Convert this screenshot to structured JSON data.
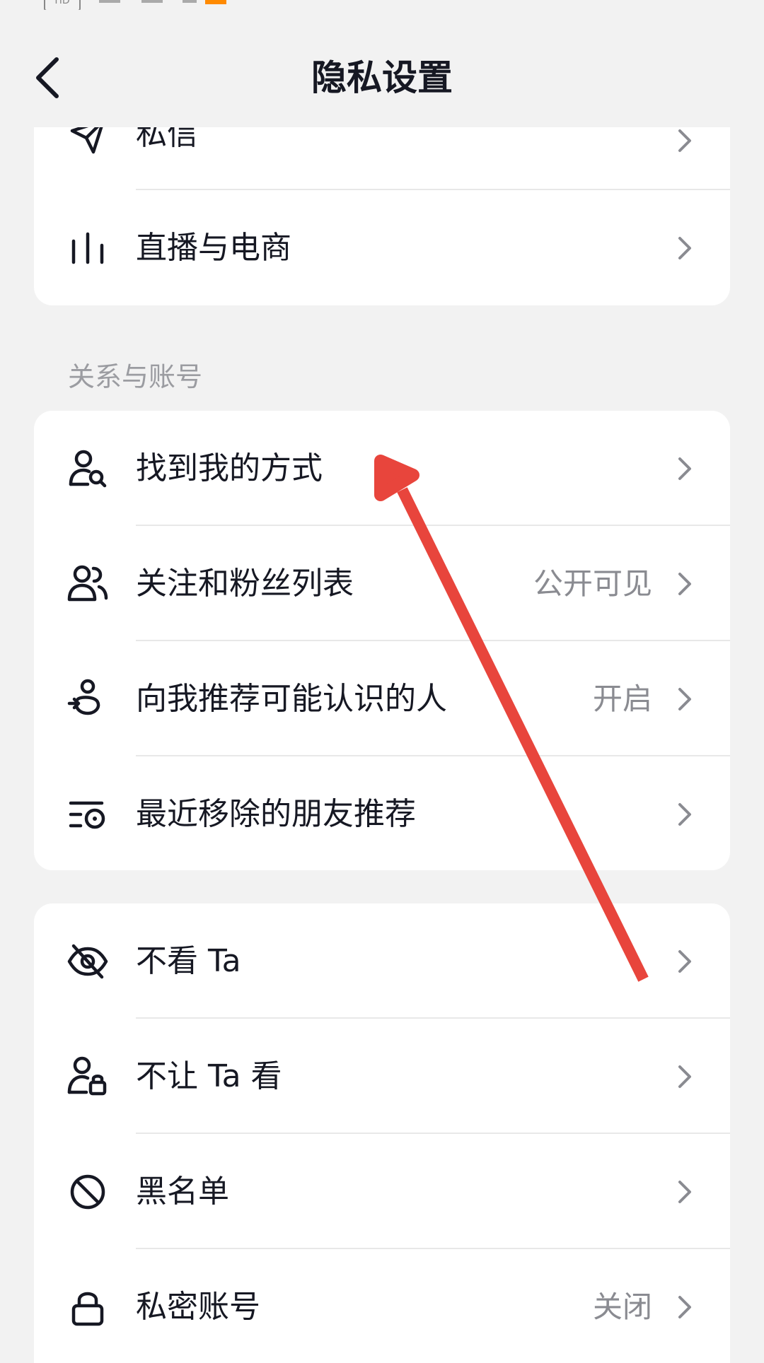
{
  "status_bar": {
    "hd_badge": "HD"
  },
  "header": {
    "title": "隐私设置",
    "back_icon": "chevron-left-icon"
  },
  "top_card": {
    "items": [
      {
        "label": "私信",
        "icon": "paper-plane-icon"
      },
      {
        "label": "直播与电商",
        "icon": "bar-chart-icon"
      }
    ]
  },
  "relations_section": {
    "title": "关系与账号",
    "items": [
      {
        "label": "找到我的方式",
        "value": "",
        "icon": "user-search-icon"
      },
      {
        "label": "关注和粉丝列表",
        "value": "公开可见",
        "icon": "users-icon"
      },
      {
        "label": "向我推荐可能认识的人",
        "value": "开启",
        "icon": "user-recommend-icon"
      },
      {
        "label": "最近移除的朋友推荐",
        "value": "",
        "icon": "list-eye-icon"
      }
    ]
  },
  "visibility_card": {
    "items": [
      {
        "label": "不看 Ta",
        "value": "",
        "icon": "eye-off-icon"
      },
      {
        "label": "不让 Ta 看",
        "value": "",
        "icon": "user-lock-icon"
      },
      {
        "label": "黑名单",
        "value": "",
        "icon": "block-icon"
      },
      {
        "label": "私密账号",
        "value": "关闭",
        "icon": "lock-icon"
      }
    ]
  },
  "colors": {
    "background": "#f2f2f2",
    "card": "#ffffff",
    "text_primary": "#161823",
    "text_secondary": "#8a8b91",
    "annotation_arrow": "#e8453c"
  }
}
